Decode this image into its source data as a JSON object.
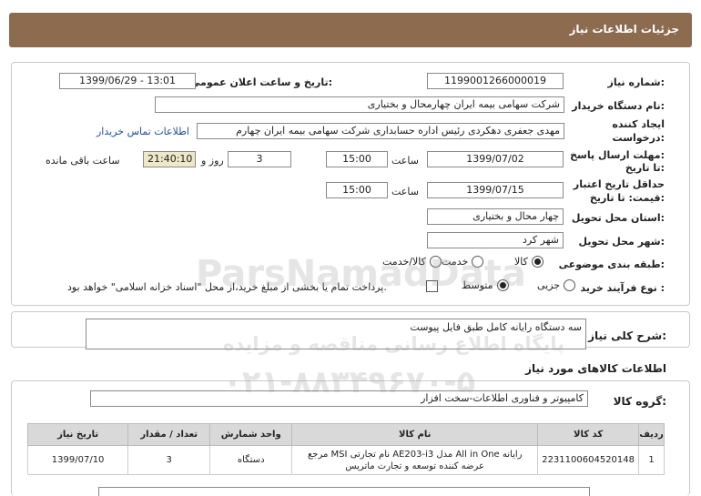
{
  "header": {
    "title": "جزئیات اطلاعات نیاز"
  },
  "form": {
    "need_number_label": "شماره نیاز:",
    "need_number": "1199001266000019",
    "announce_label": "تاریخ و ساعت اعلان عمومی:",
    "announce_value": "1399/06/29 - 13:01",
    "buyer_label": "نام دستگاه خریدار:",
    "buyer_value": "شرکت سهامی بیمه ایران چهارمحال و بختیاری",
    "creator_label_1": "ایجاد کننده",
    "creator_label_2": "درخواست:",
    "creator_value": "مهدی جعفری دهکردی رئیس اداره حسابداری شرکت سهامی بیمه ایران چهارم",
    "contact_link": "اطلاعات تماس خریدار",
    "reply_label_1": "مهلت ارسال پاسخ:",
    "reply_label_2": "تا تاریخ:",
    "reply_date": "1399/07/02",
    "time_label": "ساعت",
    "reply_time": "15:00",
    "days_value": "3",
    "days_label": "روز و",
    "remaining_time": "21:40:10",
    "remaining_label": "ساعت باقی مانده",
    "validity_label_1": "حداقل تاریخ اعتبار",
    "validity_label_2": "قیمت: تا تاریخ:",
    "validity_date": "1399/07/15",
    "validity_time": "15:00",
    "province_label": "استان محل تحویل:",
    "province_value": "چهار محال و بختیاری",
    "city_label": "شهر محل تحویل:",
    "city_value": "شهر کرد",
    "category_label": "طبقه بندی موضوعی:",
    "category_options": [
      "کالا",
      "خدمت",
      "کالا/خدمت"
    ],
    "category_selected": "کالا",
    "process_label": "نوع فرآیند خرید :",
    "process_options": [
      "جزیی",
      "متوسط"
    ],
    "process_selected": "متوسط",
    "treasury_text": "پرداخت تمام یا بخشی از مبلغ خرید،از محل \"اسناد خزانه اسلامی\" خواهد بود."
  },
  "description": {
    "label": "شرح کلی نیاز:",
    "value": "سه دستگاه رایانه کامل طبق فایل پیوست"
  },
  "goods": {
    "section_title": "اطلاعات کالاهای مورد نیاز",
    "group_label": "گروه کالا:",
    "group_value": "کامپیوتر و فناوری اطلاعات-سخت افزار",
    "columns": [
      "ردیف",
      "کد کالا",
      "نام کالا",
      "واحد شمارش",
      "تعداد / مقدار",
      "تاریخ نیاز"
    ],
    "rows": [
      {
        "row": "1",
        "code": "2231100604520148",
        "name": "رایانه All in One مدل AE203-i3 نام تجارتی MSI مرجع عرضه کننده توسعه و تجارت ماتریس",
        "unit": "دستگاه",
        "qty": "3",
        "date": "1399/07/10"
      }
    ]
  },
  "watermark": {
    "brand": "ParsNamadData",
    "line1": "پایگاه اطلاع رسانی مناقصه و مزایده",
    "phone": "۰۲۱-۸۸۳۴۹۶۷۰-۵"
  }
}
